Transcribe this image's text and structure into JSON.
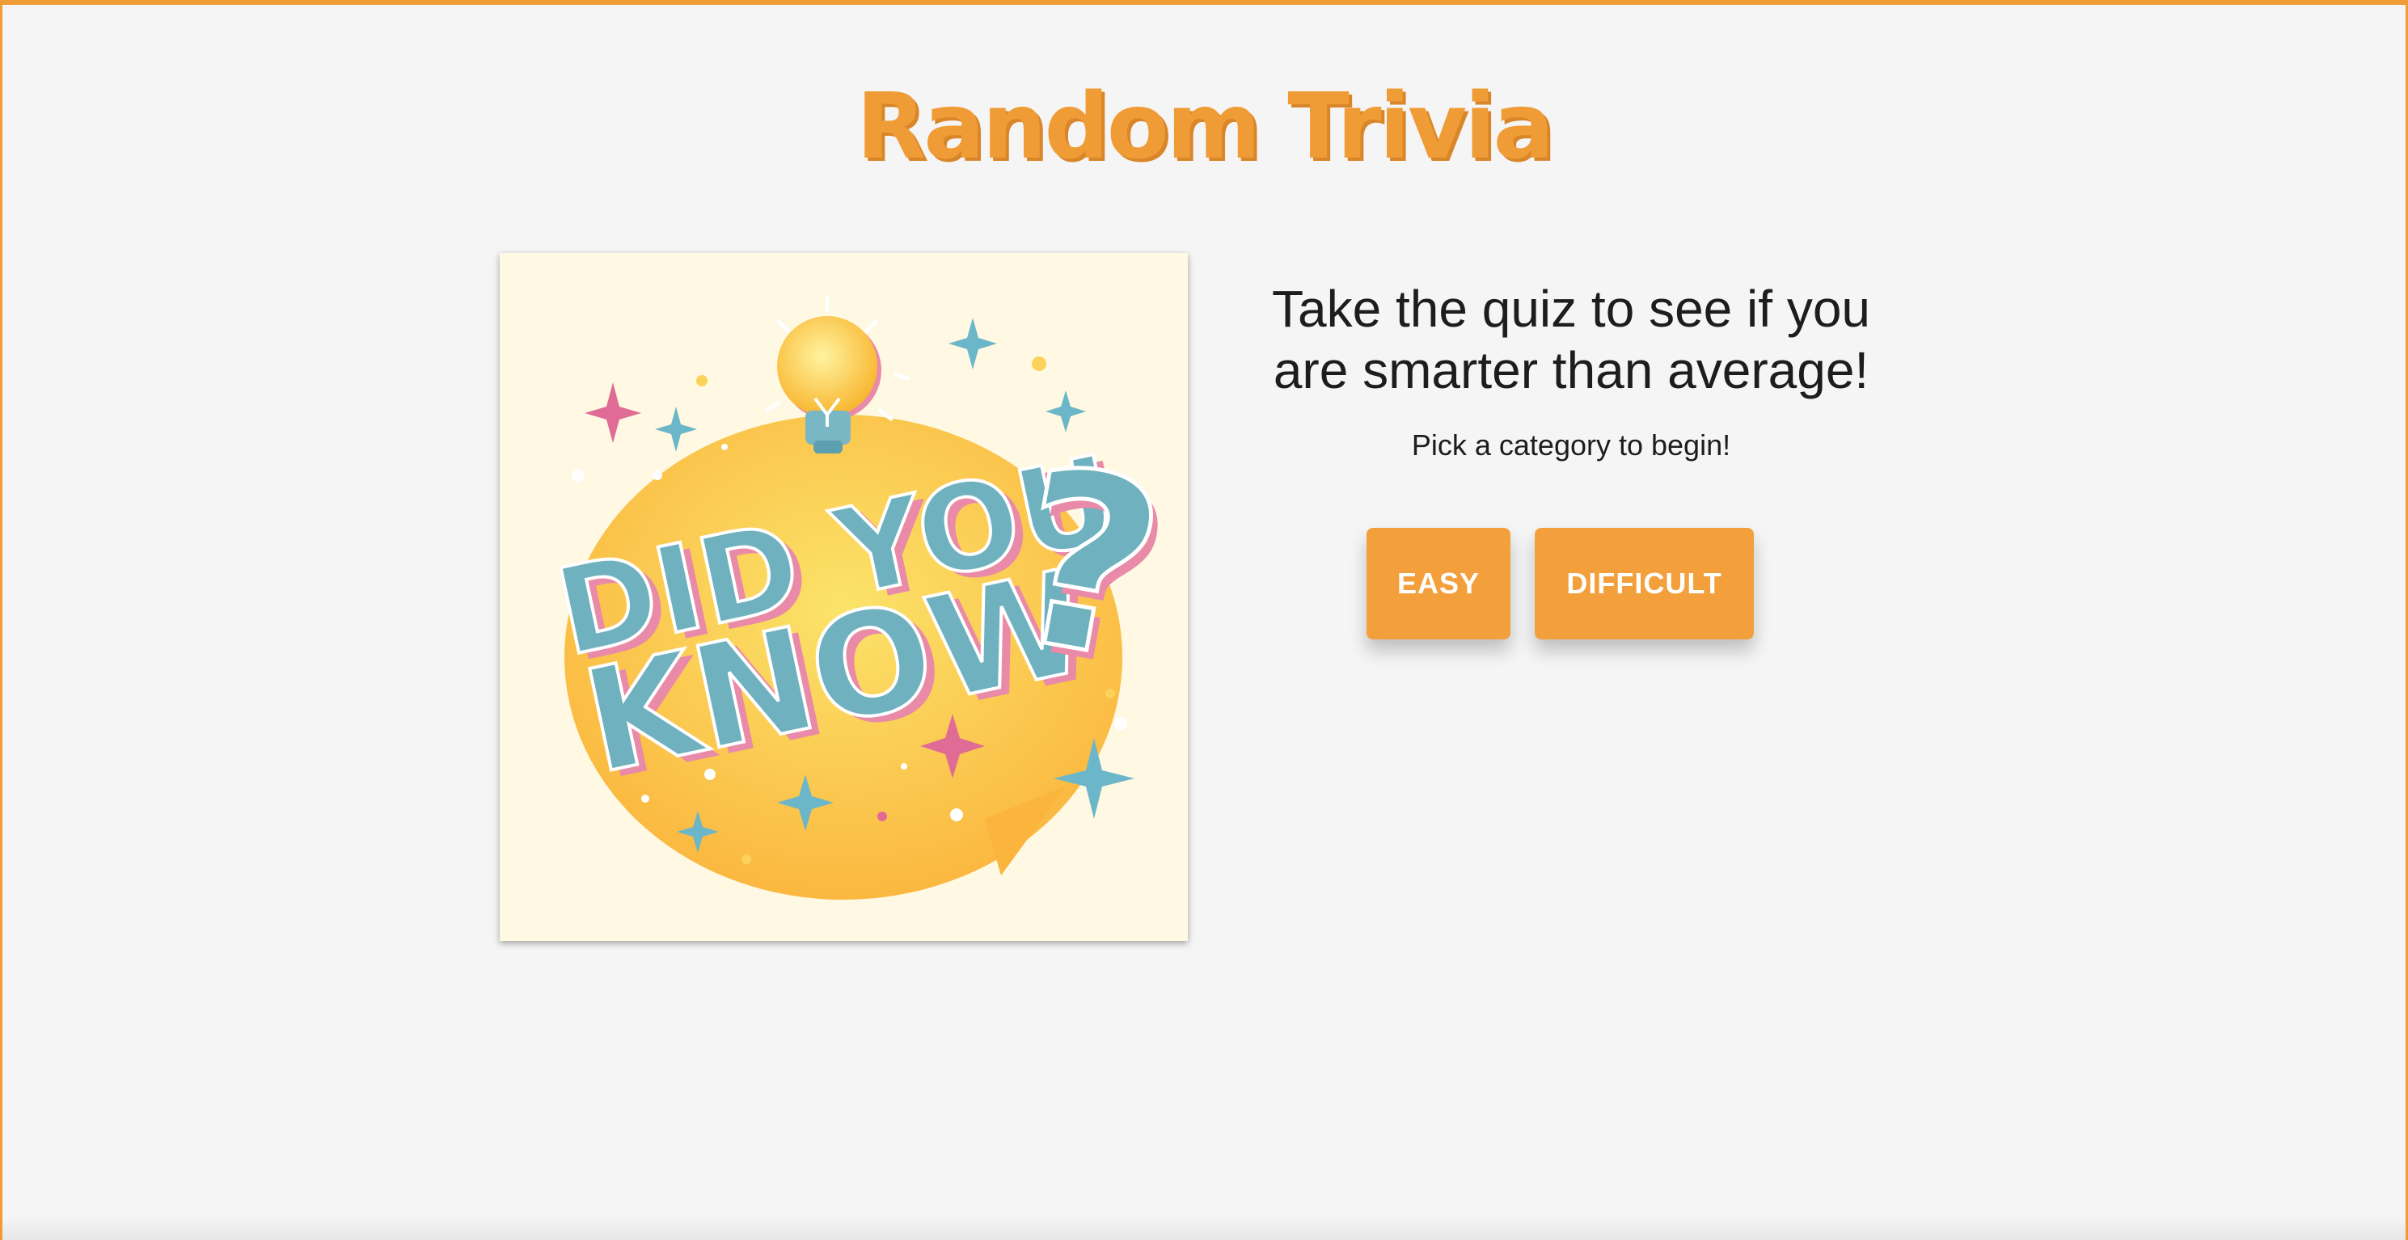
{
  "page": {
    "title": "Random Trivia",
    "accent_color": "#f09c36",
    "background_color": "#f5f5f5"
  },
  "hero": {
    "image_icon": "did-you-know-illustration",
    "line1": "DID YOU",
    "line2": "KNOW",
    "mark": "?"
  },
  "intro": {
    "headline": "Take the quiz to see if you are smarter than average!",
    "subtext": "Pick a category to begin!"
  },
  "buttons": {
    "easy_label": "EASY",
    "difficult_label": "DIFFICULT",
    "color": "#f3a03c"
  }
}
